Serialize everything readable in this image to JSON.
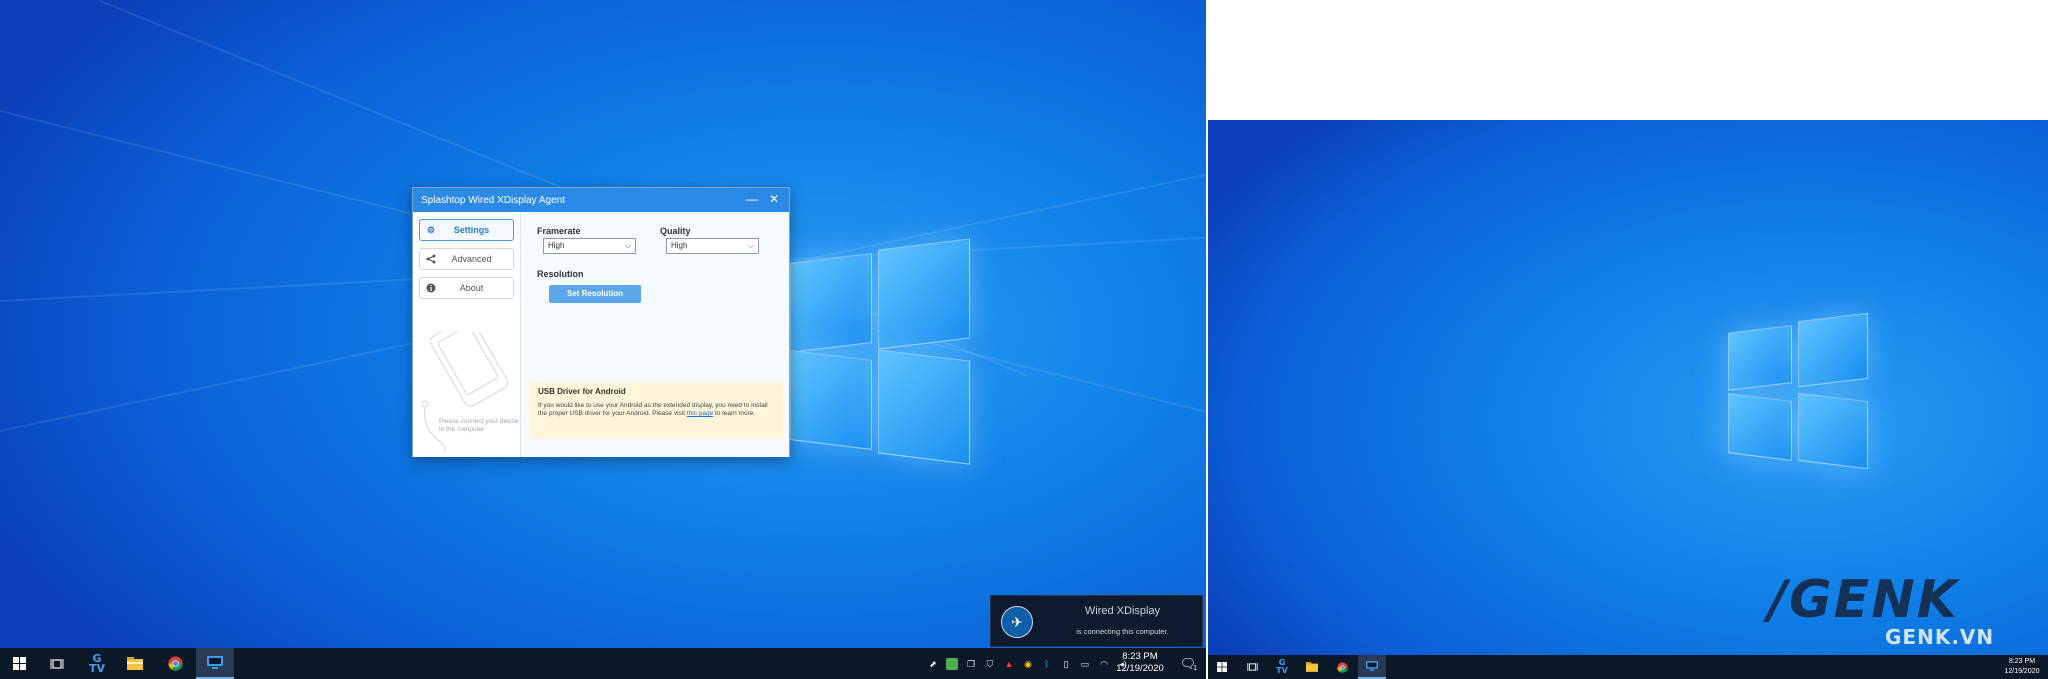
{
  "app": {
    "title": "Splashtop Wired XDisplay Agent",
    "minimize_glyph": "—",
    "close_glyph": "✕",
    "sidebar": [
      {
        "label": "Settings",
        "icon": "gear-icon",
        "active": true
      },
      {
        "label": "Advanced",
        "icon": "share-icon",
        "active": false
      },
      {
        "label": "About",
        "icon": "info-icon",
        "active": false
      }
    ],
    "framerate": {
      "label": "Framerate",
      "value": "High"
    },
    "quality": {
      "label": "Quality",
      "value": "High"
    },
    "resolution": {
      "label": "Resolution",
      "button": "Set Resolution"
    },
    "usb": {
      "title": "USB Driver for Android",
      "text_before": "If you would like to use your Android as the extended display, you need to install the proper USB driver for your Android. Please visit ",
      "link": "this page",
      "text_after": " to learn more."
    },
    "connect_hint": "Please connect your device to the computer"
  },
  "toast": {
    "title": "Wired XDisplay",
    "message": "is connecting this computer."
  },
  "taskbar_main": {
    "time": "8:23 PM",
    "date": "12/19/2020",
    "tray_icons": [
      "network-icon",
      "app-tray-icon",
      "copy-icon",
      "shield-icon",
      "acrobat-icon",
      "chrome-tray-icon",
      "bluetooth-icon",
      "usb-icon",
      "battery-icon",
      "wifi-icon",
      "volume-icon"
    ],
    "notification_count": "1"
  },
  "taskbar_second": {
    "time": "8:23 PM",
    "date": "12/19/2020"
  },
  "watermark": {
    "logo": "/GENK",
    "site": "GENK.VN"
  },
  "colors": {
    "accent": "#2b8ae6",
    "taskbar": "#0b1828",
    "desktop": "#0f7ee6"
  }
}
